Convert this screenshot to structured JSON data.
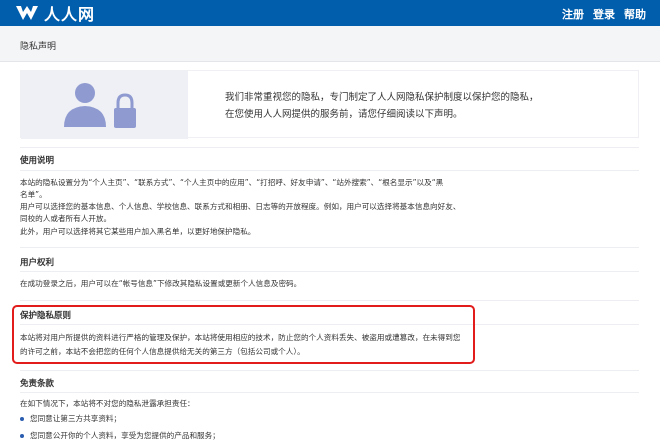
{
  "header": {
    "logo_text": "人人网",
    "nav": [
      {
        "label": "注册"
      },
      {
        "label": "登录"
      },
      {
        "label": "帮助"
      }
    ],
    "colors": {
      "bar": "#005eac"
    }
  },
  "page": {
    "title": "隐私声明"
  },
  "banner": {
    "line1": "我们非常重视您的隐私，专门制定了人人网隐私保护制度以保护您的隐私，",
    "line2": "在您使用人人网提供的服务前，请您仔细阅读以下声明。"
  },
  "sections": {
    "usage": {
      "title": "使用说明",
      "lines": [
        "本站的隐私设置分为“个人主页”、“联系方式”、“个人主页中的应用”、“打招呼、好友申请”、“站外搜索”、“根名显示”以及“黑",
        "名单”。",
        "用户可以选择您的基本信息、个人信息、学校信息、联系方式和相册、日志等的开放程度。例如，用户可以选择将基本信息向好友、",
        "同校的人或者所有人开放。",
        "此外，用户可以选择将其它某些用户加入黑名单，以更好地保护隐私。"
      ]
    },
    "rights": {
      "title": "用户权利",
      "lines": [
        "在成功登录之后，用户可以在“帐号信息”下修改其隐私设置或更新个人信息及密码。"
      ]
    },
    "principles": {
      "title": "保护隐私原则",
      "lines": [
        "本站将对用户所提供的资料进行严格的管理及保护，本站将使用相应的技术，防止您的个人资料丢失、被盗用或遭篡改，在未得到您",
        "的许可之前，本站不会把您的任何个人信息提供给无关的第三方（包括公司或个人）。"
      ]
    },
    "disclaimer": {
      "title": "免责条款",
      "intro": "在如下情况下，本站将不对您的隐私泄露承担责任：",
      "bullets": [
        "您同意让第三方共享资料；",
        "您同意公开你的个人资料，享受为您提供的产品和服务；"
      ]
    }
  }
}
